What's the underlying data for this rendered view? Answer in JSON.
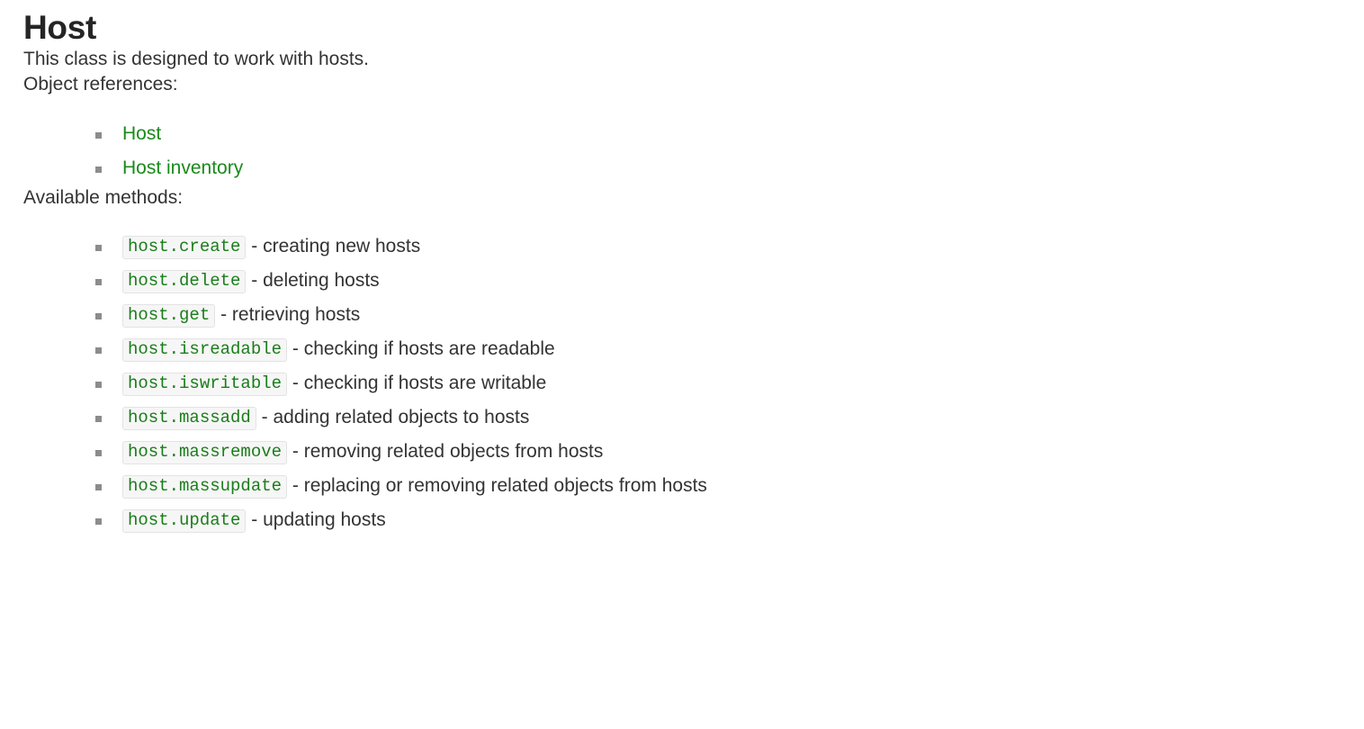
{
  "page": {
    "title": "Host",
    "intro": "This class is designed to work with hosts.",
    "object_references_label": "Object references:",
    "available_methods_label": "Available methods:"
  },
  "colors": {
    "link_green": "#1a8a1a",
    "code_green": "#1a7d1a",
    "code_background": "#f6f6f6",
    "code_border": "#e3e3e3",
    "text": "#333333",
    "heading": "#252525",
    "bullet": "#8c8c8c",
    "page_background": "#ffffff"
  },
  "object_references": [
    {
      "label": "Host"
    },
    {
      "label": "Host inventory"
    }
  ],
  "methods": [
    {
      "code": "host.create",
      "desc": "- creating new hosts"
    },
    {
      "code": "host.delete",
      "desc": "- deleting hosts"
    },
    {
      "code": "host.get",
      "desc": "- retrieving hosts"
    },
    {
      "code": "host.isreadable",
      "desc": "- checking if hosts are readable"
    },
    {
      "code": "host.iswritable",
      "desc": "- checking if hosts are writable"
    },
    {
      "code": "host.massadd",
      "desc": "- adding related objects to hosts"
    },
    {
      "code": "host.massremove",
      "desc": "- removing related objects from hosts"
    },
    {
      "code": "host.massupdate",
      "desc": "- replacing or removing related objects from hosts"
    },
    {
      "code": "host.update",
      "desc": "- updating hosts"
    }
  ]
}
